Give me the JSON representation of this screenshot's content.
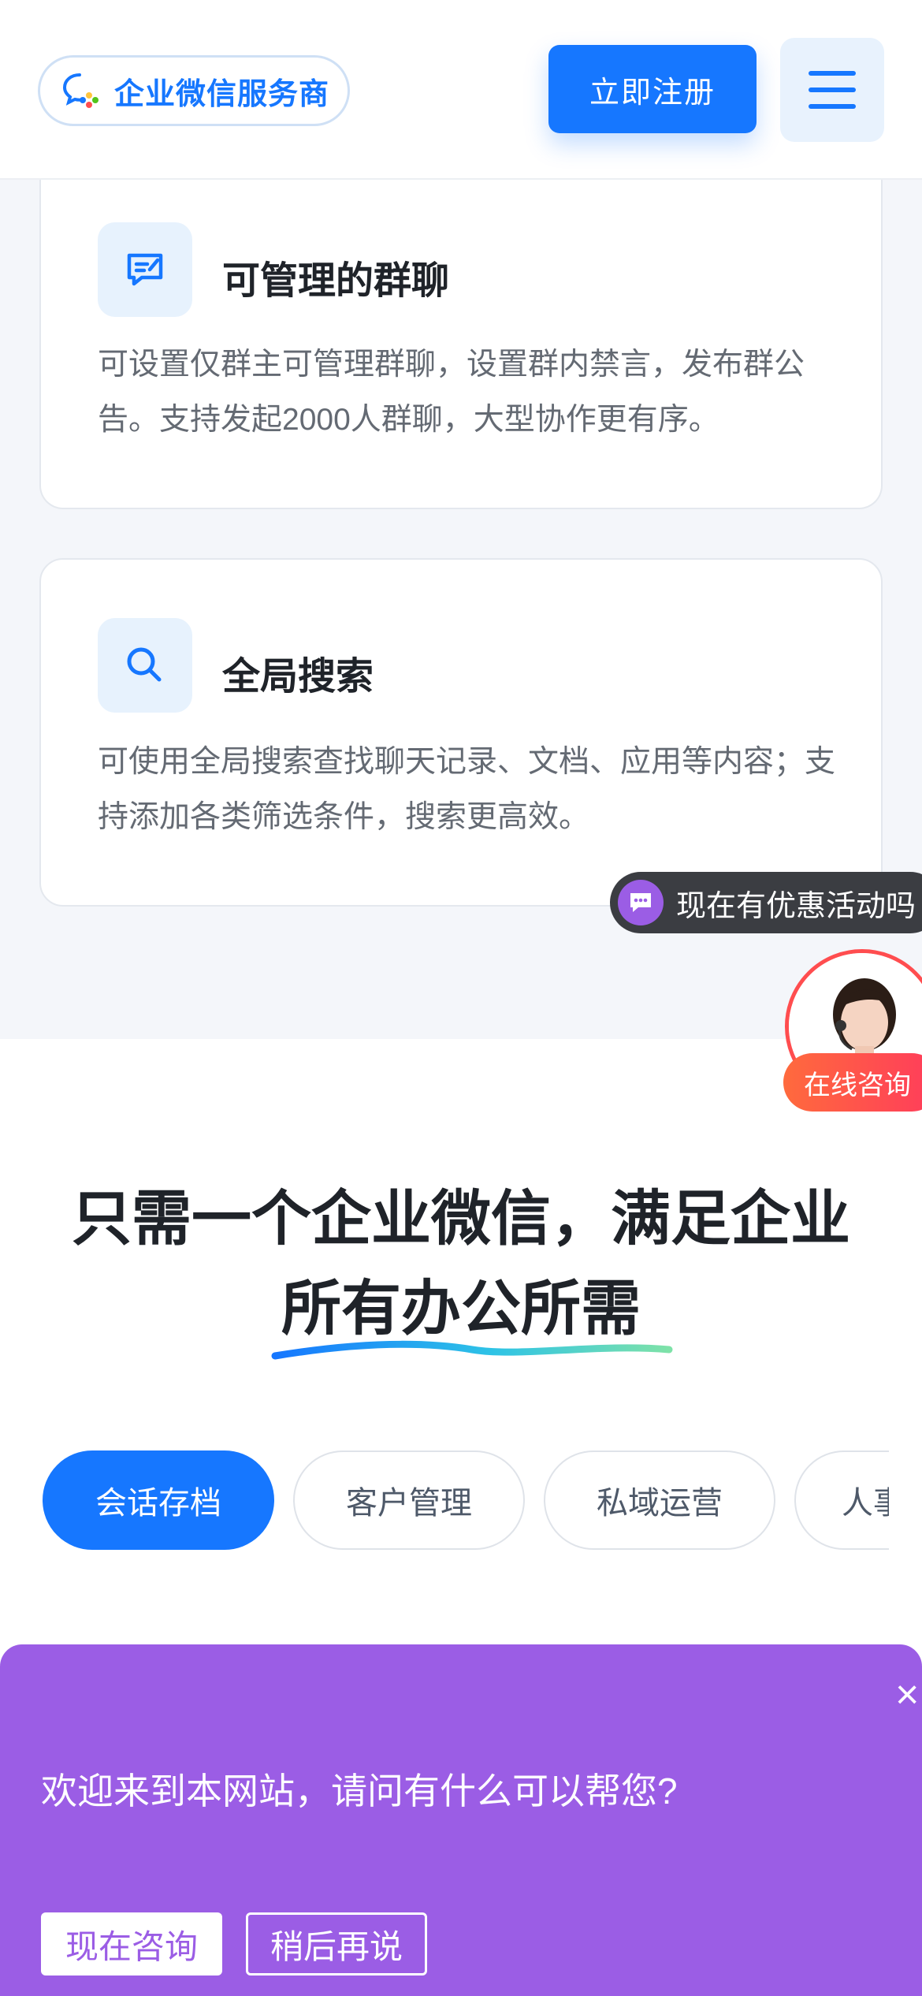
{
  "header": {
    "brand_name": "企业微信服务商",
    "brand_icon": "chat-bubble-icon",
    "register_label": "立即注册",
    "menu_icon": "hamburger-menu-icon",
    "accent_color": "#1677ff"
  },
  "features": [
    {
      "icon": "group-chat-icon",
      "title": "可管理的群聊",
      "description": "可设置仅群主可管理群聊，设置群内禁言，发布群公告。支持发起2000人群聊，大型协作更有序。"
    },
    {
      "icon": "search-icon",
      "title": "全局搜索",
      "description": "可使用全局搜索查找聊天记录、文档、应用等内容；支持添加各类筛选条件，搜索更高效。"
    }
  ],
  "promo": {
    "icon": "chat-dots-icon",
    "text": "现在有优惠活动吗"
  },
  "consult": {
    "avatar": "consultant-avatar",
    "label": "在线咨询"
  },
  "section": {
    "headline_line1": "只需一个企业微信，满足企业",
    "headline_line2": "所有办公所需",
    "tabs": [
      {
        "label": "会话存档",
        "active": true
      },
      {
        "label": "客户管理",
        "active": false
      },
      {
        "label": "私域运营",
        "active": false
      },
      {
        "label": "人事",
        "active": false
      }
    ]
  },
  "chat_popup": {
    "message": "欢迎来到本网站，请问有什么可以帮您?",
    "close_symbol": "×",
    "primary_label": "现在咨询",
    "secondary_label": "稍后再说",
    "background_color": "#9b5de5"
  }
}
